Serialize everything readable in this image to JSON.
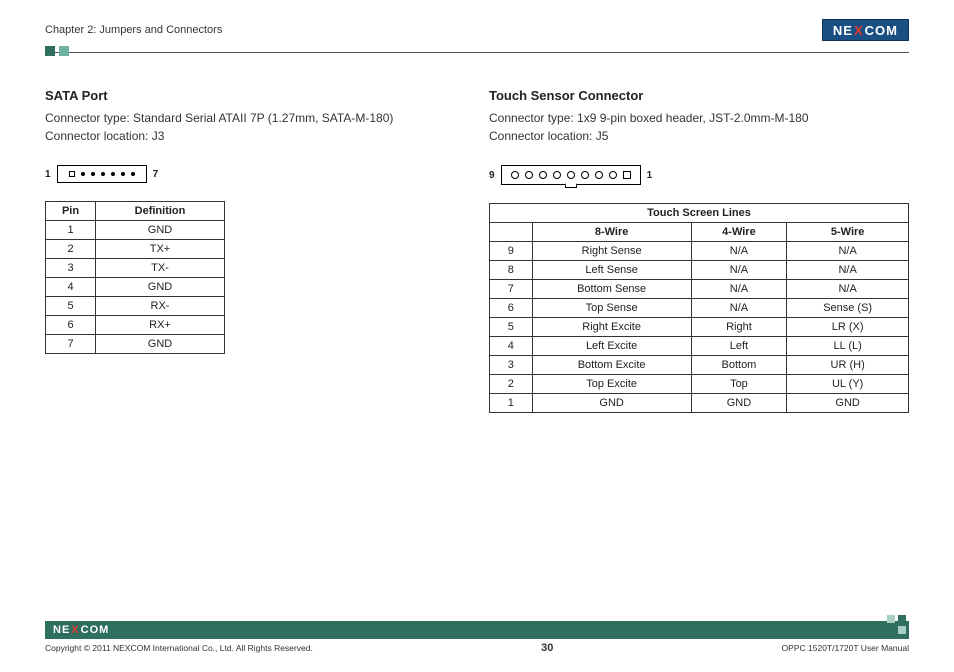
{
  "header": {
    "chapter": "Chapter 2: Jumpers and Connectors",
    "logo_pre": "NE",
    "logo_x": "X",
    "logo_post": "COM"
  },
  "left": {
    "title": "SATA Port",
    "conn_type": "Connector type: Standard Serial ATAII 7P (1.27mm, SATA-M-180)",
    "conn_loc": "Connector location: J3",
    "pin_left": "1",
    "pin_right": "7",
    "table": {
      "head": [
        "Pin",
        "Definition"
      ],
      "rows": [
        [
          "1",
          "GND"
        ],
        [
          "2",
          "TX+"
        ],
        [
          "3",
          "TX-"
        ],
        [
          "4",
          "GND"
        ],
        [
          "5",
          "RX-"
        ],
        [
          "6",
          "RX+"
        ],
        [
          "7",
          "GND"
        ]
      ]
    }
  },
  "right": {
    "title": "Touch Sensor Connector",
    "conn_type": "Connector type: 1x9 9-pin boxed header, JST-2.0mm-M-180",
    "conn_loc": "Connector location: J5",
    "pin_left": "9",
    "pin_right": "1",
    "table": {
      "title": "Touch Screen Lines",
      "sub": [
        "",
        "8-Wire",
        "4-Wire",
        "5-Wire"
      ],
      "rows": [
        [
          "9",
          "Right Sense",
          "N/A",
          "N/A"
        ],
        [
          "8",
          "Left Sense",
          "N/A",
          "N/A"
        ],
        [
          "7",
          "Bottom Sense",
          "N/A",
          "N/A"
        ],
        [
          "6",
          "Top Sense",
          "N/A",
          "Sense (S)"
        ],
        [
          "5",
          "Right Excite",
          "Right",
          "LR (X)"
        ],
        [
          "4",
          "Left Excite",
          "Left",
          "LL (L)"
        ],
        [
          "3",
          "Bottom Excite",
          "Bottom",
          "UR (H)"
        ],
        [
          "2",
          "Top Excite",
          "Top",
          "UL (Y)"
        ],
        [
          "1",
          "GND",
          "GND",
          "GND"
        ]
      ]
    }
  },
  "footer": {
    "logo_pre": "NE",
    "logo_x": "X",
    "logo_post": "COM",
    "copyright": "Copyright © 2011 NEXCOM International Co., Ltd. All Rights Reserved.",
    "page": "30",
    "manual": "OPPC 1520T/1720T User Manual"
  }
}
